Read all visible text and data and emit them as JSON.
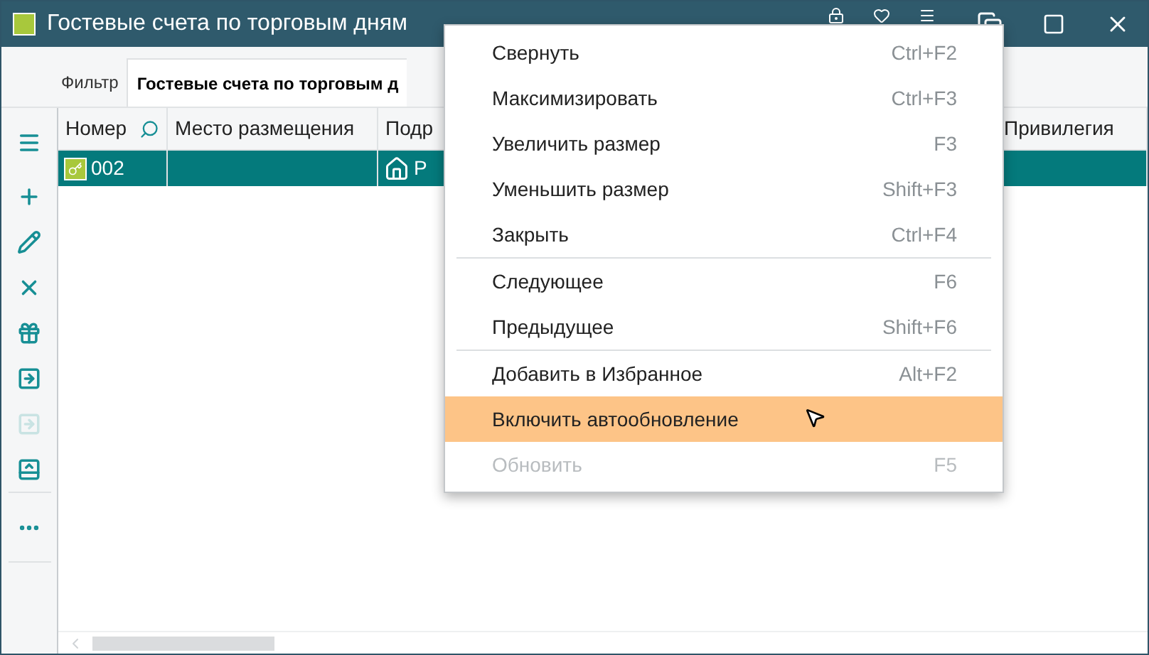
{
  "window": {
    "title": "Гостевые счета по торговым дням"
  },
  "tabs": [
    {
      "label": "Фильтр",
      "selected": false
    },
    {
      "label": "Гостевые счета по торговым д",
      "selected": true
    }
  ],
  "toolbar": [
    {
      "kind": "menu",
      "disabled": false
    },
    {
      "kind": "add",
      "disabled": false
    },
    {
      "kind": "edit",
      "disabled": false
    },
    {
      "kind": "delete",
      "disabled": false
    },
    {
      "kind": "gift",
      "disabled": false
    },
    {
      "kind": "import",
      "disabled": false
    },
    {
      "kind": "import",
      "disabled": true
    },
    {
      "kind": "layout",
      "disabled": false
    },
    {
      "kind": "more",
      "disabled": false
    }
  ],
  "table": {
    "columns": [
      "Номер",
      "Место размещения",
      "Подр",
      "Привилегия"
    ],
    "rows": [
      {
        "selected": true,
        "cells": [
          "002",
          "",
          "Р",
          ""
        ]
      }
    ]
  },
  "context_menu": [
    {
      "label": "Свернуть",
      "shortcut": "Ctrl+F2",
      "separator_before": false,
      "selected": false,
      "disabled": false
    },
    {
      "label": "Максимизировать",
      "shortcut": "Ctrl+F3",
      "separator_before": false,
      "selected": false,
      "disabled": false
    },
    {
      "label": "Увеличить размер",
      "shortcut": "F3",
      "separator_before": false,
      "selected": false,
      "disabled": false
    },
    {
      "label": "Уменьшить размер",
      "shortcut": "Shift+F3",
      "separator_before": false,
      "selected": false,
      "disabled": false
    },
    {
      "label": "Закрыть",
      "shortcut": "Ctrl+F4",
      "separator_before": false,
      "selected": false,
      "disabled": false
    },
    {
      "label": "Следующее",
      "shortcut": "F6",
      "separator_before": true,
      "selected": false,
      "disabled": false
    },
    {
      "label": "Предыдущее",
      "shortcut": "Shift+F6",
      "separator_before": false,
      "selected": false,
      "disabled": false
    },
    {
      "label": "Добавить в Избранное",
      "shortcut": "Alt+F2",
      "separator_before": true,
      "selected": false,
      "disabled": false
    },
    {
      "label": "Включить автообновление",
      "separator_before": false,
      "selected": true,
      "disabled": false
    },
    {
      "label": "Обновить",
      "shortcut": "F5",
      "separator_before": false,
      "selected": false,
      "disabled": true
    }
  ]
}
